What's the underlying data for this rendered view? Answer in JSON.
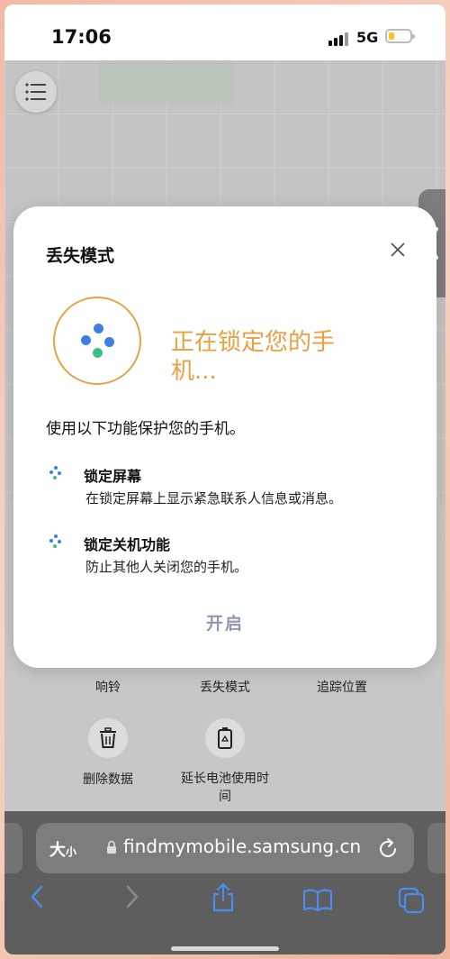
{
  "status_bar": {
    "time": "17:06",
    "network": "5G",
    "battery_level": 0.25
  },
  "modal": {
    "title": "丢失模式",
    "status_text": "正在锁定您的手机...",
    "intro": "使用以下功能保护您的手机。",
    "features": [
      {
        "title": "锁定屏幕",
        "description": "在锁定屏幕上显示紧急联系人信息或消息。"
      },
      {
        "title": "锁定关机功能",
        "description": "防止其他人关闭您的手机。"
      }
    ],
    "start_label": "开启"
  },
  "actions": {
    "ring_label": "响铃",
    "lost_mode_label": "丢失模式",
    "track_label": "追踪位置",
    "erase_label": "删除数据",
    "battery_label_line1": "延长电池使用时",
    "battery_label_line2": "间"
  },
  "browser": {
    "text_size_label": "大",
    "text_size_small": "小",
    "url": "findmymobile.samsung.cn"
  },
  "colors": {
    "accent_orange": "#eaa040",
    "dot_blue": "#3f7fe0",
    "dot_green": "#3fbf86",
    "start_disabled": "#8d9aae"
  }
}
